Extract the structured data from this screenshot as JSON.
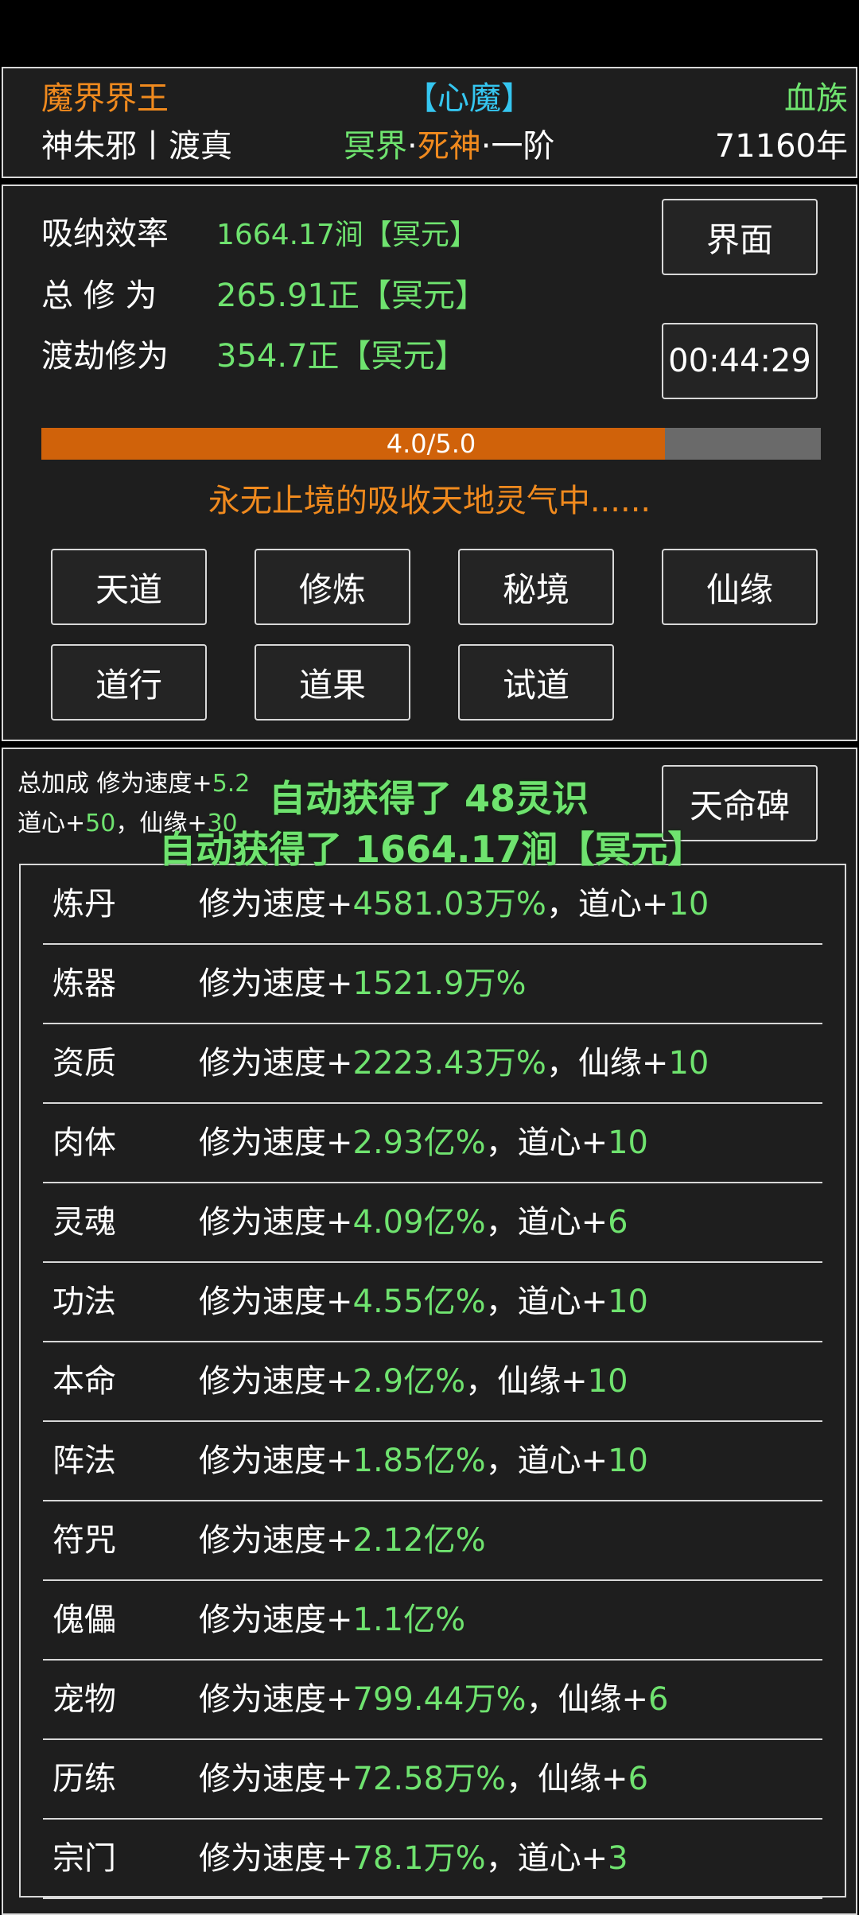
{
  "header": {
    "realm_title": "魔界界王",
    "demon_tag": "【心魔】",
    "race": "血族",
    "name": "神朱邪丨渡真",
    "realm_a": "冥界",
    "dot1": "·",
    "realm_b": "死神",
    "dot2": "·",
    "stage": "一阶",
    "age": "71160年"
  },
  "stats": {
    "absorb_label": "吸纳效率",
    "absorb_value": "1664.17涧【冥元】",
    "total_label": "总 修 为",
    "total_value": "265.91正【冥元】",
    "tribulation_label": "渡劫修为",
    "tribulation_value": "354.7正【冥元】",
    "interface_button": "界面",
    "timer": "00:44:29"
  },
  "progress": {
    "text": "4.0/5.0",
    "value": 0.8
  },
  "status_message": "永无止境的吸收天地灵气中......",
  "menu": [
    {
      "label": "天道"
    },
    {
      "label": "修炼"
    },
    {
      "label": "秘境"
    },
    {
      "label": "仙缘"
    },
    {
      "label": "道行"
    },
    {
      "label": "道果"
    },
    {
      "label": "试道"
    }
  ],
  "bonus": {
    "line1_prefix": "总加成 修为速度+",
    "line1_value": "5.2",
    "line2_prefix": "道心+",
    "line2_value": "50",
    "line2_suffix": "，仙缘+",
    "line2_value2": "30",
    "stele_button": "天命碑"
  },
  "notifications": [
    "自动获得了 48灵识",
    "自动获得了 1664.17涧【冥元】"
  ],
  "rows": [
    {
      "name": "炼丹",
      "prefix": "修为速度+",
      "value": "4581.03万%",
      "sep": "，道心+",
      "extra": "10"
    },
    {
      "name": "炼器",
      "prefix": "修为速度+",
      "value": "1521.9万%",
      "sep": "",
      "extra": ""
    },
    {
      "name": "资质",
      "prefix": "修为速度+",
      "value": "2223.43万%",
      "sep": "，仙缘+",
      "extra": "10"
    },
    {
      "name": "肉体",
      "prefix": "修为速度+",
      "value": "2.93亿%",
      "sep": "，道心+",
      "extra": "10"
    },
    {
      "name": "灵魂",
      "prefix": "修为速度+",
      "value": "4.09亿%",
      "sep": "，道心+",
      "extra": "6"
    },
    {
      "name": "功法",
      "prefix": "修为速度+",
      "value": "4.55亿%",
      "sep": "，道心+",
      "extra": "10"
    },
    {
      "name": "本命",
      "prefix": "修为速度+",
      "value": "2.9亿%",
      "sep": "，仙缘+",
      "extra": "10"
    },
    {
      "name": "阵法",
      "prefix": "修为速度+",
      "value": "1.85亿%",
      "sep": "，道心+",
      "extra": "10"
    },
    {
      "name": "符咒",
      "prefix": "修为速度+",
      "value": "2.12亿%",
      "sep": "",
      "extra": ""
    },
    {
      "name": "傀儡",
      "prefix": "修为速度+",
      "value": "1.1亿%",
      "sep": "",
      "extra": ""
    },
    {
      "name": "宠物",
      "prefix": "修为速度+",
      "value": "799.44万%",
      "sep": "，仙缘+",
      "extra": "6"
    },
    {
      "name": "历练",
      "prefix": "修为速度+",
      "value": "72.58万%",
      "sep": "，仙缘+",
      "extra": "6"
    },
    {
      "name": "宗门",
      "prefix": "修为速度+",
      "value": "78.1万%",
      "sep": "，道心+",
      "extra": "3"
    }
  ]
}
